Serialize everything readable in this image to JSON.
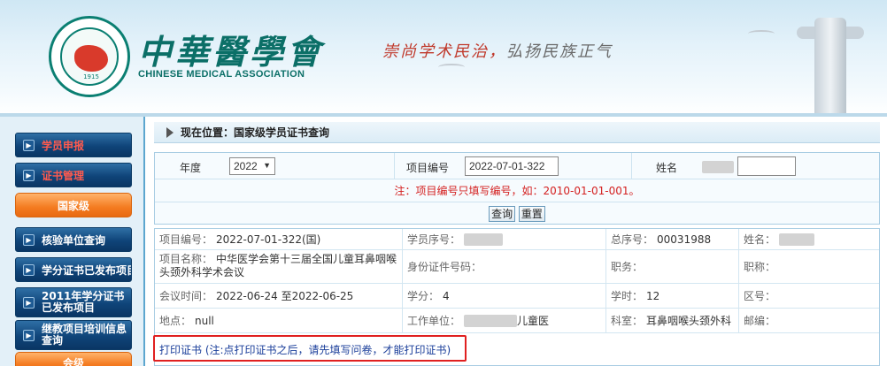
{
  "header": {
    "brand_cn": "中華醫學會",
    "brand_en": "CHINESE MEDICAL ASSOCIATION",
    "motto_a": "崇尚学术民治，",
    "motto_b": "弘扬民族正气",
    "logo_year": "1915"
  },
  "sidebar": {
    "items": [
      {
        "label": "学员申报",
        "style": "red"
      },
      {
        "label": "证书管理",
        "style": "red"
      },
      {
        "label": "国家级",
        "style": "orange"
      },
      {
        "label": "核验单位查询",
        "style": "blue"
      },
      {
        "label": "学分证书已发布项目",
        "style": "blue"
      },
      {
        "label": "2011年学分证书已发布项目",
        "style": "blue"
      },
      {
        "label": "继教项目培训信息查询",
        "style": "blue"
      },
      {
        "label": "会级",
        "style": "orange"
      }
    ]
  },
  "breadcrumb": {
    "text": "现在位置：国家级学员证书查询"
  },
  "search": {
    "year_label": "年度",
    "year_value": "2022",
    "project_no_label": "项目编号",
    "project_no_value": "2022-07-01-322",
    "name_label": "姓名",
    "note": "注：项目编号只填写编号，如：2010-01-01-001。",
    "query_button": "查询",
    "reset_button": "重置"
  },
  "result": {
    "project_no_label": "项目编号：",
    "project_no_value": "2022-07-01-322(国)",
    "student_no_label": "学员序号：",
    "total_no_label": "总序号：",
    "total_no_value": "00031988",
    "name_label": "姓名：",
    "project_name_label": "项目名称：",
    "project_name_value": "中华医学会第十三届全国儿童耳鼻咽喉头颈外科学术会议",
    "id_label": "身份证件号码：",
    "job_label": "职务：",
    "title_label": "职称：",
    "meeting_time_label": "会议时间：",
    "meeting_time_value": "2022-06-24 至2022-06-25",
    "credit_label": "学分：",
    "credit_value": "4",
    "hours_label": "学时：",
    "hours_value": "12",
    "district_label": "区号：",
    "location_label": "地点：",
    "location_value": "null",
    "work_unit_label": "工作单位：",
    "work_unit_suffix": "儿童医",
    "dept_label": "科室：",
    "dept_value": "耳鼻咽喉头颈外科",
    "postcode_label": "邮编：",
    "print_text": "打印证书 (注:点打印证书之后，请先填写问卷，才能打印证书)"
  }
}
